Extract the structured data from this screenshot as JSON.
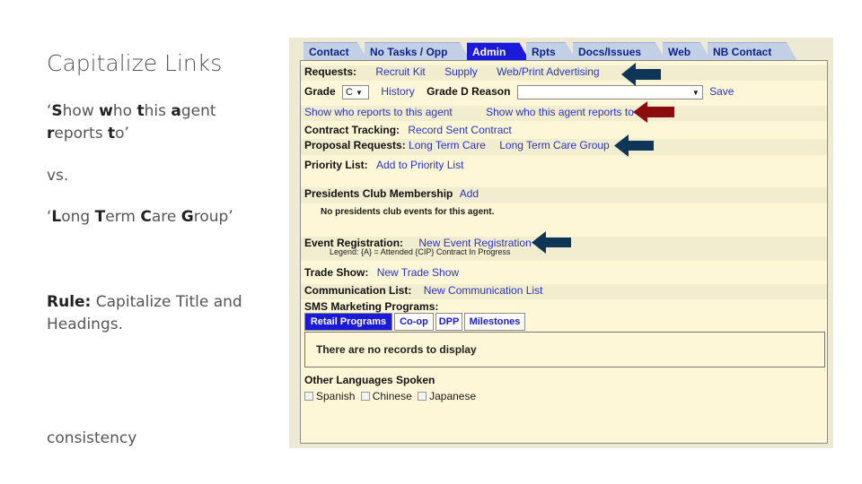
{
  "slide": {
    "title": "Capitalize Links",
    "example1": [
      {
        "t": "‘",
        "b": false
      },
      {
        "t": "S",
        "b": true
      },
      {
        "t": "how ",
        "b": false
      },
      {
        "t": "w",
        "b": true
      },
      {
        "t": "ho ",
        "b": false
      },
      {
        "t": "t",
        "b": true
      },
      {
        "t": "his ",
        "b": false
      },
      {
        "t": "a",
        "b": true
      },
      {
        "t": "gent ",
        "b": false
      },
      {
        "t": "r",
        "b": true
      },
      {
        "t": "eports ",
        "b": false
      },
      {
        "t": "t",
        "b": true
      },
      {
        "t": "o’",
        "b": false
      }
    ],
    "vs": "vs.",
    "example2": [
      {
        "t": "‘",
        "b": false
      },
      {
        "t": "L",
        "b": true
      },
      {
        "t": "ong ",
        "b": false
      },
      {
        "t": "T",
        "b": true
      },
      {
        "t": "erm ",
        "b": false
      },
      {
        "t": "C",
        "b": true
      },
      {
        "t": "are ",
        "b": false
      },
      {
        "t": "G",
        "b": true
      },
      {
        "t": "roup’",
        "b": false
      }
    ],
    "rule_label": "Rule:",
    "rule_text": " Capitalize Title and Headings.",
    "footer": "consistency"
  },
  "app": {
    "tabs": [
      "Contact",
      "No Tasks / Opp",
      "Admin",
      "Rpts",
      "Docs/Issues",
      "Web",
      "NB Contact"
    ],
    "active_tab": "Admin",
    "requests": {
      "label": "Requests:",
      "links": [
        "Recruit Kit",
        "Supply",
        "Web/Print Advertising"
      ]
    },
    "grade": {
      "label": "Grade",
      "value": "C",
      "history": "History",
      "reason_label": "Grade D Reason",
      "reason_value": "",
      "save": "Save"
    },
    "reports": {
      "link1": "Show who reports to this agent",
      "link2": "Show who this agent reports to"
    },
    "contract_tracking": {
      "label": "Contract Tracking:",
      "link": "Record Sent Contract"
    },
    "proposal": {
      "label": "Proposal Requests:",
      "links": [
        "Long Term Care",
        "Long Term Care Group"
      ]
    },
    "priority": {
      "label": "Priority List:",
      "link": "Add to Priority List"
    },
    "presidents": {
      "label": "Presidents Club Membership",
      "link": "Add",
      "empty": "No presidents club events for this agent."
    },
    "events": {
      "label": "Event Registration:",
      "link": "New Event Registration",
      "legend": "Legend: {A} = Attended   {CIP} Contract In Progress"
    },
    "trade": {
      "label": "Trade Show:",
      "link": "New Trade Show"
    },
    "comm": {
      "label": "Communication List:",
      "link": "New Communication List"
    },
    "sms": {
      "label": "SMS Marketing Programs:"
    },
    "program_tabs": [
      "Retail Programs",
      "Co-op",
      "DPP",
      "Milestones"
    ],
    "no_records": "There are no records to display",
    "languages": {
      "label": "Other Languages Spoken",
      "options": [
        "Spanish",
        "Chinese",
        "Japanese"
      ]
    }
  },
  "colors": {
    "tab_active": "#1a1ad8",
    "arrow_blue": "#0e3659",
    "arrow_red": "#8b0c0c",
    "link": "#2633c9"
  }
}
